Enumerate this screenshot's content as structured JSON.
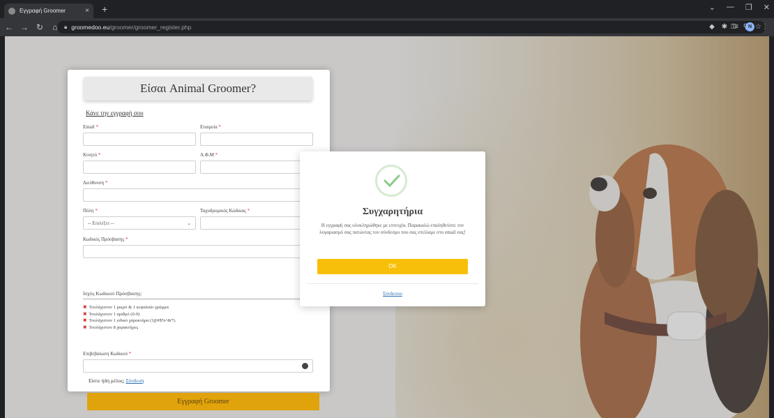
{
  "browser": {
    "tab_title": "Εγγραφή Groomer",
    "tab_close": "×",
    "new_tab": "+",
    "url_host": "groomedoo.eu",
    "url_path": "/groomer/groomer_register.php",
    "profile_initial": "N",
    "window_controls": [
      "⌄",
      "—",
      "❐",
      "✕"
    ]
  },
  "form": {
    "title": "Είσαι Animal Groomer?",
    "subtitle": "Κάνε την εγγραφή σου",
    "email_label": "Email",
    "company_label": "Εταιρεία",
    "mobile_label": "Κινητό",
    "vat_label": "Α.Φ.Μ",
    "address_label": "Διεύθυνση",
    "city_label": "Πόλη",
    "city_value": "-- Επιλέξτε --",
    "postal_label": "Ταχυδρομικός Κώδικας",
    "password_label": "Κωδικός Πρόσβασης",
    "strength_label": "Ισχύς Κωδικού Πρόσβασης:",
    "rules": [
      "Τουλάχιστον 1 μικρό & 1 κεφαλαίο γράμμα",
      "Τουλάχιστον 1 αριθμό (0-9)",
      "Τουλάχιστον 1 ειδικό χαρακτήρα (!@#$%^&*).",
      "Τουλάχιστον 8 χαρακτήρες"
    ],
    "confirm_label": "Επιβεβαίωση Κωδικού",
    "required_mark": "*",
    "member_text": "Είστε ήδη μέλος;",
    "login_link": "Σύνδεση",
    "submit_label": "Εγγραφή Groomer"
  },
  "modal": {
    "title": "Συγχαρητήρια",
    "message": "Η εγγραφή σας ολοκληρώθηκε με επιτυχία. Παρακαλώ επαληθεύστε τον λογαριασμό σας πατώντας τον σύνδεσμο που σας στείλαμε στο email σας!",
    "ok_label": "OK",
    "link_label": "Σύνδεσου",
    "success_color": "#8cc98a",
    "button_color": "#f8bf0a"
  }
}
